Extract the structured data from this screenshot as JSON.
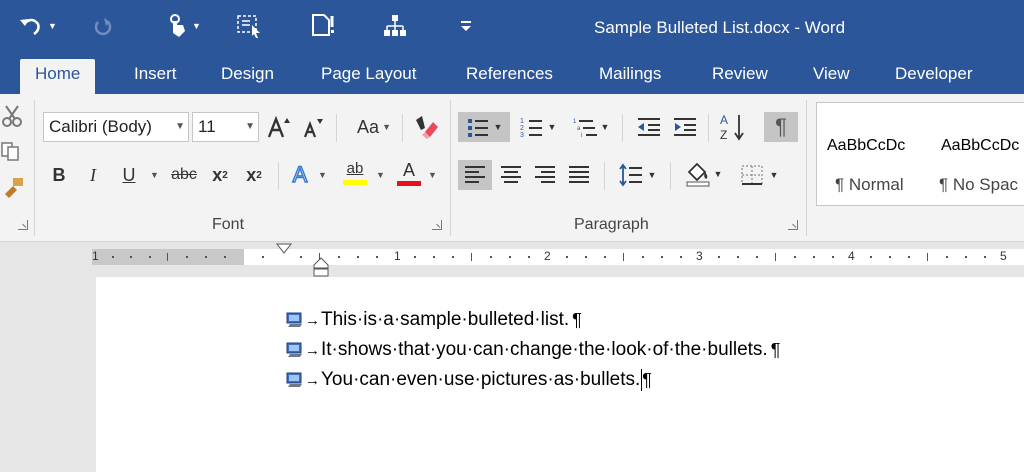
{
  "title": "Sample Bulleted List.docx - Word",
  "quick_access": {
    "undo": "undo-icon",
    "redo": "redo-icon",
    "touch": "touch-mode-icon",
    "select": "select-icon",
    "new_doc": "new-document-icon",
    "tree": "organization-chart-icon",
    "customize": "customize-arrow-icon"
  },
  "tabs": [
    "Home",
    "Insert",
    "Design",
    "Page Layout",
    "References",
    "Mailings",
    "Review",
    "View",
    "Developer"
  ],
  "active_tab": "Home",
  "font": {
    "name": "Calibri (Body)",
    "size": "11",
    "group_label": "Font",
    "change_case": "Aa",
    "bold": "B",
    "italic": "I",
    "underline": "U",
    "strikethrough": "abc",
    "subscript": "x",
    "subscript_mark": "2",
    "superscript": "x",
    "superscript_mark": "2",
    "text_effects": "A",
    "highlight_letters": "ab",
    "font_color": "A",
    "highlight_color": "#ffff00",
    "font_color_value": "#e8101b"
  },
  "paragraph": {
    "group_label": "Paragraph",
    "show_marks": "¶"
  },
  "styles": [
    {
      "sample": "AaBbCcDc",
      "name": "¶ Normal"
    },
    {
      "sample": "AaBbCcDc",
      "name": "¶ No Spac"
    }
  ],
  "ruler": {
    "numbers": [
      "1",
      "1",
      "2",
      "3",
      "4",
      "5"
    ]
  },
  "document": {
    "lines": [
      "This·is·a·sample·bulleted·list.",
      "It·shows·that·you·can·change·the·look·of·the·bullets.",
      "You·can·even·use·pictures·as·bullets."
    ],
    "tab_mark": "→",
    "paragraph_mark": "¶"
  },
  "colors": {
    "brand": "#2b579a",
    "ribbon": "#f3f3f3",
    "selected": "#c5c5c5"
  }
}
